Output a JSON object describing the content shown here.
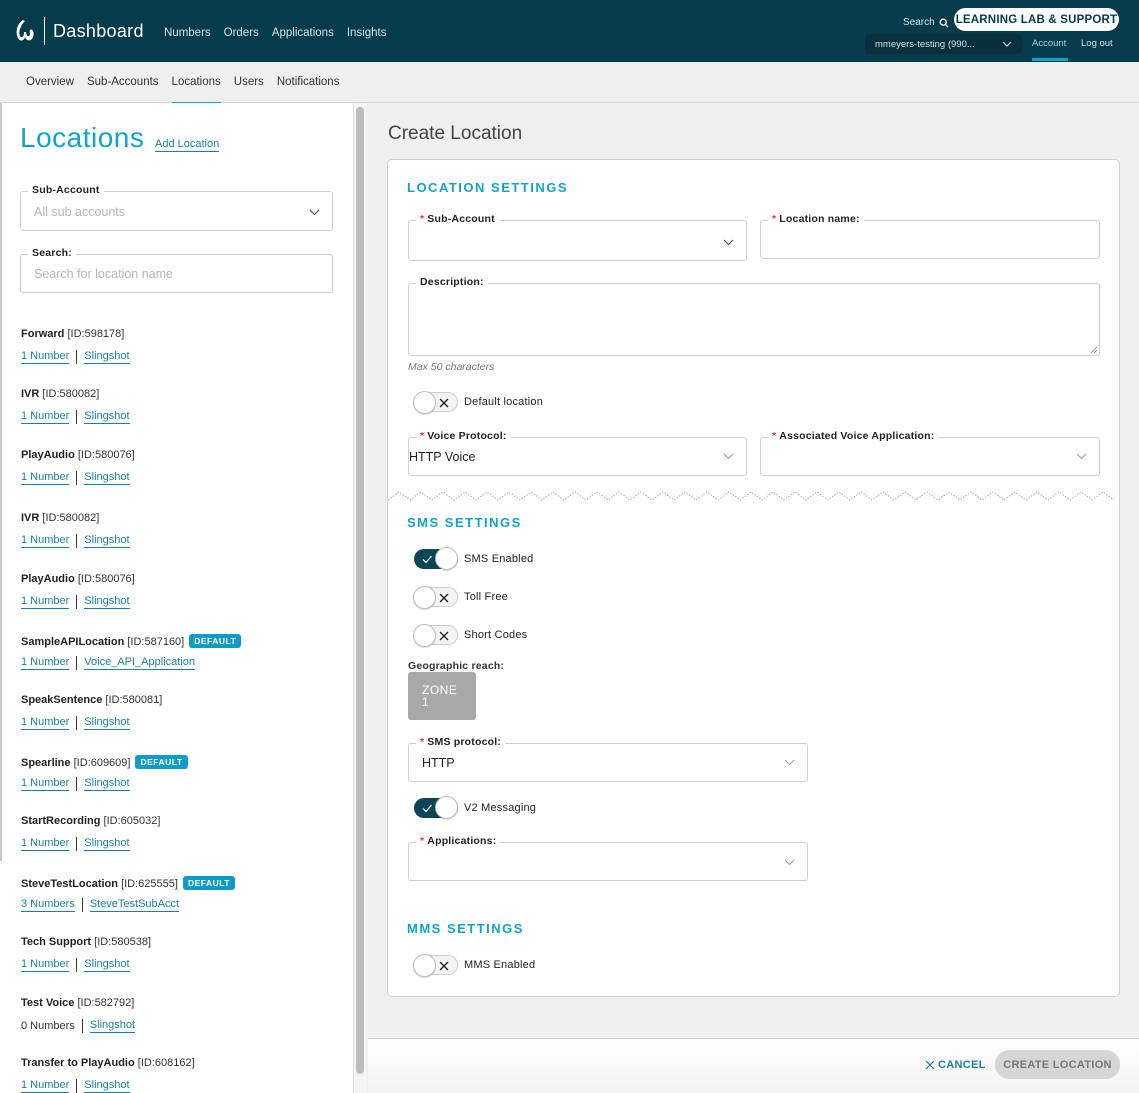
{
  "header": {
    "brand": "Dashboard",
    "nav": [
      "Numbers",
      "Orders",
      "Applications",
      "Insights"
    ],
    "search_label": "Search",
    "learning_lab_label": "LEARNING LAB & SUPPORT",
    "account_selector": "mmeyers-testing (990...",
    "account_link": "Account",
    "logout_link": "Log out"
  },
  "subnav": {
    "items": [
      "Overview",
      "Sub-Accounts",
      "Locations",
      "Users",
      "Notifications"
    ],
    "active": "Locations"
  },
  "sidebar": {
    "title": "Locations",
    "add_location": "Add Location",
    "sub_account_label": "Sub-Account",
    "sub_account_placeholder": "All sub accounts",
    "search_label": "Search:",
    "search_placeholder": "Search for location name",
    "locations": [
      {
        "name": "Forward",
        "id": "[ID:598178]",
        "numbers": "1 Number",
        "numbers_link": true,
        "app": "Slingshot",
        "default": false
      },
      {
        "name": "IVR",
        "id": "[ID:580082]",
        "numbers": "1 Number",
        "numbers_link": true,
        "app": "Slingshot",
        "default": false
      },
      {
        "name": "PlayAudio",
        "id": "[ID:580076]",
        "numbers": "1 Number",
        "numbers_link": true,
        "app": "Slingshot",
        "default": false
      },
      {
        "name": "IVR",
        "id": "[ID:580082]",
        "numbers": "1 Number",
        "numbers_link": true,
        "app": "Slingshot",
        "default": false
      },
      {
        "name": "PlayAudio",
        "id": "[ID:580076]",
        "numbers": "1 Number",
        "numbers_link": true,
        "app": "Slingshot",
        "default": false
      },
      {
        "name": "SampleAPILocation",
        "id": "[ID:587160]",
        "numbers": "1 Number",
        "numbers_link": true,
        "app": "Voice_API_Application",
        "default": true
      },
      {
        "name": "SpeakSentence",
        "id": "[ID:580081]",
        "numbers": "1 Number",
        "numbers_link": true,
        "app": "Slingshot",
        "default": false
      },
      {
        "name": "Spearline",
        "id": "[ID:609609]",
        "numbers": "1 Number",
        "numbers_link": true,
        "app": "Slingshot",
        "default": true
      },
      {
        "name": "StartRecording",
        "id": "[ID:605032]",
        "numbers": "1 Number",
        "numbers_link": true,
        "app": "Slingshot",
        "default": false
      },
      {
        "name": "SteveTestLocation",
        "id": "[ID:625555]",
        "numbers": "3 Numbers",
        "numbers_link": true,
        "app": "SteveTestSubAcct",
        "default": true
      },
      {
        "name": "Tech Support",
        "id": "[ID:580538]",
        "numbers": "1 Number",
        "numbers_link": true,
        "app": "Slingshot",
        "default": false
      },
      {
        "name": "Test Voice",
        "id": "[ID:582792]",
        "numbers": "0 Numbers",
        "numbers_link": false,
        "app": "Slingshot",
        "default": false
      },
      {
        "name": "Transfer to PlayAudio",
        "id": "[ID:608162]",
        "numbers": "1 Number",
        "numbers_link": true,
        "app": "Slingshot",
        "default": false
      }
    ],
    "default_badge": "DEFAULT"
  },
  "form": {
    "title": "Create Location",
    "location_settings": {
      "heading": "LOCATION SETTINGS",
      "sub_account_label": "Sub-Account",
      "sub_account_value": "",
      "location_name_label": "Location name:",
      "location_name_value": "",
      "description_label": "Description:",
      "description_value": "",
      "description_hint": "Max 50 characters",
      "default_location_label": "Default location",
      "default_location_on": false,
      "voice_protocol_label": "Voice Protocol:",
      "voice_protocol_value": "HTTP Voice",
      "voice_app_label": "Associated Voice Application:",
      "voice_app_value": ""
    },
    "sms_settings": {
      "heading": "SMS SETTINGS",
      "sms_enabled_label": "SMS Enabled",
      "sms_enabled_on": true,
      "toll_free_label": "Toll Free",
      "toll_free_on": false,
      "short_codes_label": "Short Codes",
      "short_codes_on": false,
      "geo_reach_label": "Geographic reach:",
      "zone_label": "ZONE",
      "zone_number": "1",
      "sms_protocol_label": "SMS protocol:",
      "sms_protocol_value": "HTTP",
      "v2_messaging_label": "V2 Messaging",
      "v2_messaging_on": true,
      "applications_label": "Applications:",
      "applications_value": ""
    },
    "mms_settings": {
      "heading": "MMS SETTINGS",
      "mms_enabled_label": "MMS Enabled",
      "mms_enabled_on": false
    },
    "cancel_label": "CANCEL",
    "create_label": "CREATE LOCATION"
  },
  "colors": {
    "header_bg": "#043c4c",
    "accent": "#14a3c8",
    "link": "#1a7fa0",
    "toggle_on": "#0c4556",
    "required": "#e53935"
  }
}
